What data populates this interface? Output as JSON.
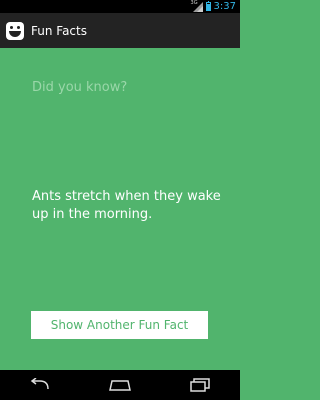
{
  "status_bar": {
    "network_type": "3G",
    "time": "3:37",
    "signal_icon": "signal-icon",
    "battery_icon": "battery-icon"
  },
  "action_bar": {
    "title": "Fun Facts",
    "app_icon": "smiley-face-icon"
  },
  "main": {
    "prompt": "Did you know?",
    "fact": "Ants stretch when they wake up in the morning.",
    "button_label": "Show Another Fun Fact"
  },
  "nav_bar": {
    "back_icon": "back-icon",
    "home_icon": "home-icon",
    "recents_icon": "recent-apps-icon"
  },
  "colors": {
    "background": "#51b46d",
    "button_text": "#51b46d",
    "prompt_text": "#9ad7a9",
    "status_accent": "#33b5e5"
  }
}
